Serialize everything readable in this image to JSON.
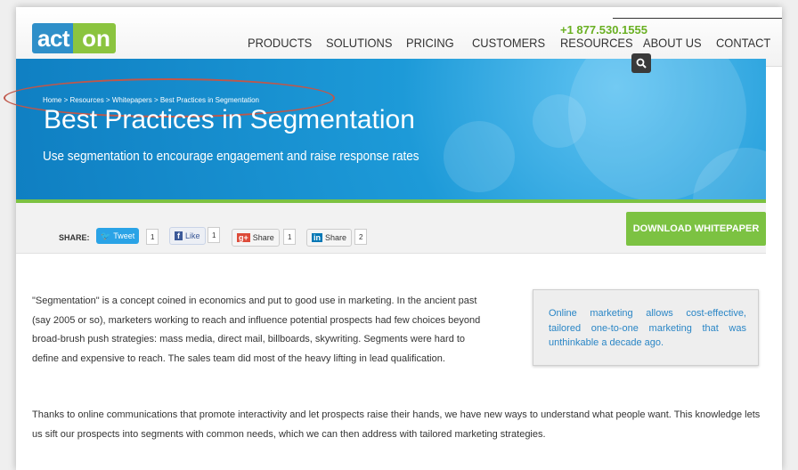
{
  "header": {
    "logo": {
      "part1": "act",
      "part2": "on"
    },
    "phone": "+1 877.530.1555",
    "nav": [
      "PRODUCTS",
      "SOLUTIONS",
      "PRICING",
      "CUSTOMERS",
      "RESOURCES",
      "ABOUT US",
      "CONTACT"
    ]
  },
  "hero": {
    "breadcrumb": "Home > Resources > Whitepapers > Best Practices in Segmentation",
    "title": "Best Practices in Segmentation",
    "subtitle": "Use segmentation to encourage engagement and raise response rates"
  },
  "share": {
    "label": "SHARE:",
    "tweet": {
      "label": "Tweet",
      "count": "1"
    },
    "like": {
      "label": "Like",
      "count": "1"
    },
    "gplus": {
      "label": "Share",
      "count": "1"
    },
    "linkedin": {
      "label": "Share",
      "count": "2"
    },
    "download": "DOWNLOAD WHITEPAPER"
  },
  "content": {
    "p1": "\"Segmentation\" is a concept coined in economics and put to good use in marketing. In the ancient past (say 2005 or so), marketers working to reach and influence potential prospects had few choices beyond broad-brush push strategies: mass media, direct mail, billboards, skywriting. Segments were hard to define and expensive to reach. The sales team did most of the heavy lifting in lead qualification.",
    "p2": "Thanks to online communications that promote interactivity and let prospects raise their hands, we have new ways to understand what people want. This knowledge lets us sift our prospects into segments with common needs, which we can then address with tailored marketing strategies.",
    "callout": "Online marketing allows cost-effective, tailored one-to-one marketing that was unthinkable a decade ago."
  },
  "colors": {
    "brand_blue": "#2e8fc9",
    "brand_green": "#7cc242",
    "link_blue": "#2a86c6"
  }
}
